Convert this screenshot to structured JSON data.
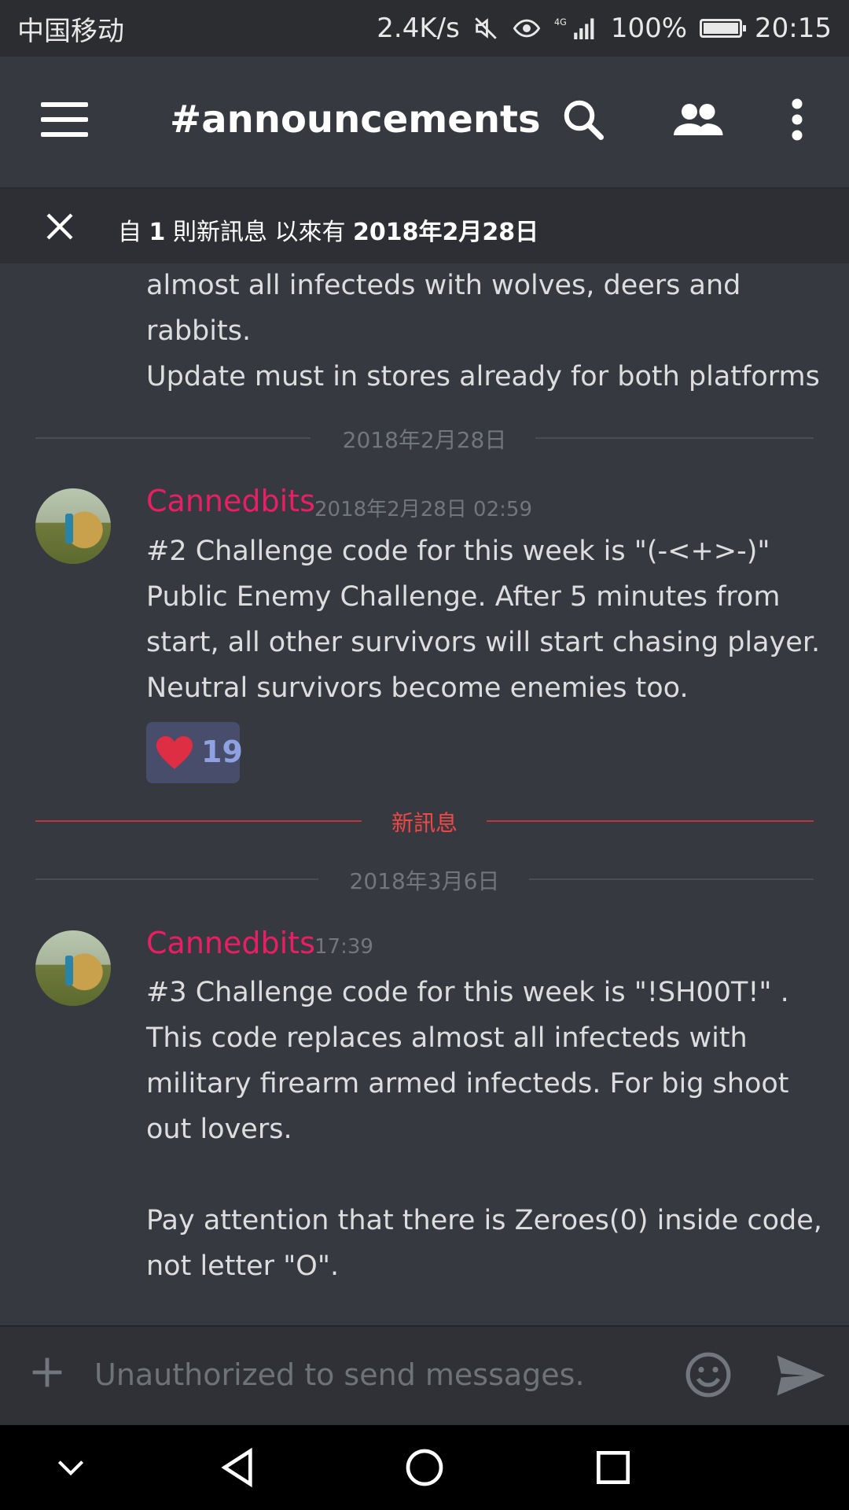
{
  "status_bar": {
    "carrier": "中国移动",
    "net_speed": "2.4K/s",
    "battery": "100%",
    "time": "20:15"
  },
  "toolbar": {
    "title": "#announcements",
    "icons": [
      "menu-icon",
      "search-icon",
      "members-icon",
      "more-vert-icon"
    ]
  },
  "new_messages_bar": {
    "prefix": "自 ",
    "count": "1",
    "middle": " 則新訊息 以來有 ",
    "date": "2018年2月28日"
  },
  "prev_message": {
    "lines": [
      "almost all infecteds with wolves, deers and",
      "rabbits.",
      "Update must in stores already for both platforms"
    ]
  },
  "dividers": {
    "date1": "2018年2月28日",
    "new_label": "新訊息",
    "date2": "2018年3月6日"
  },
  "messages": [
    {
      "author": "Cannedbits",
      "timestamp": "2018年2月28日 02:59",
      "lines": [
        "#2 Challenge code for this week is \"(-<+>-)\"",
        "Public Enemy Challenge. After 5 minutes from",
        "start, all other survivors will start chasing player.",
        "Neutral survivors become enemies too."
      ],
      "reaction": {
        "emoji": "heart",
        "count": "19"
      }
    },
    {
      "author": "Cannedbits",
      "timestamp": "17:39",
      "lines": [
        "#3 Challenge code for this week is \"!SH00T!\" .",
        "This code replaces almost all infecteds with",
        "military firearm armed infecteds. For big shoot",
        "out lovers.",
        "",
        "Pay attention that there is Zeroes(0) inside code,",
        "not letter \"O\"."
      ]
    }
  ],
  "input": {
    "placeholder": "Unauthorized to send messages."
  },
  "colors": {
    "background": "#36393f",
    "author": "#e91e63",
    "new_divider": "#f04747",
    "reaction_bg": "#474d6b",
    "reaction_count": "#8ea1e1"
  }
}
